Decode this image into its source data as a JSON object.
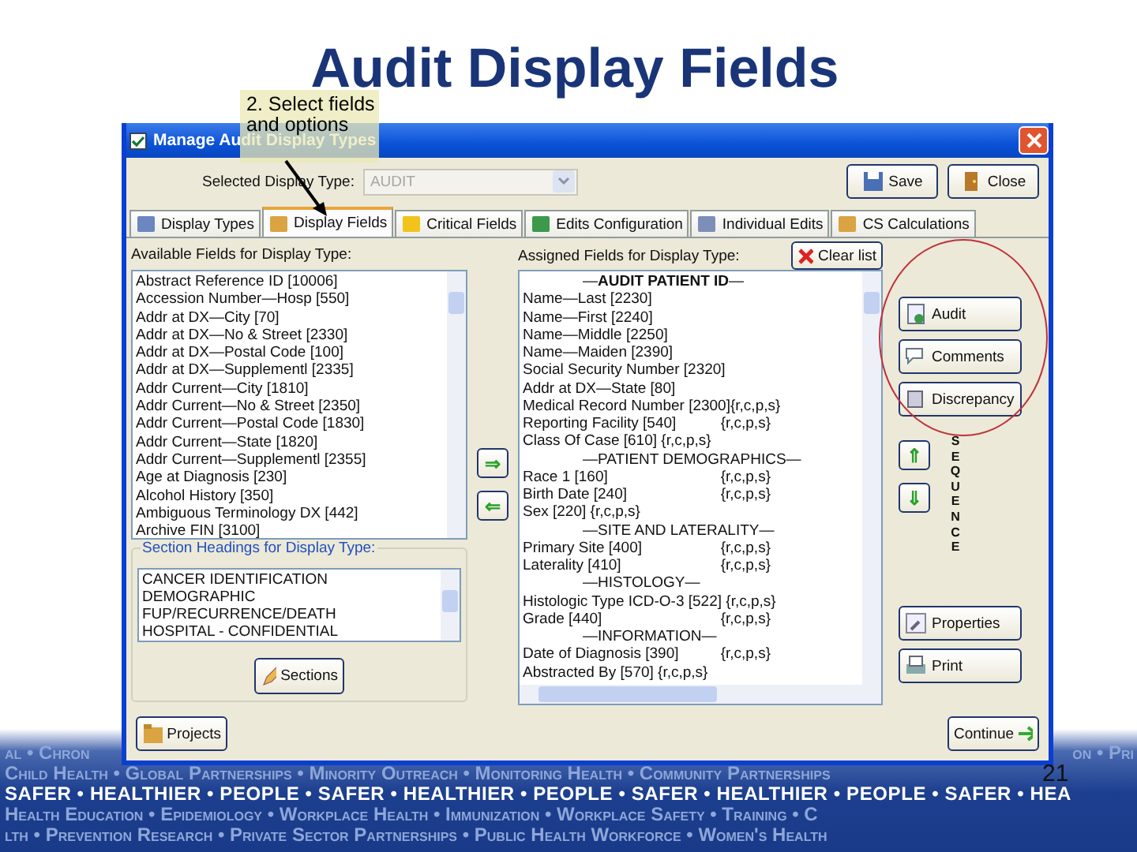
{
  "slide": {
    "title": "Audit Display Fields",
    "callout": "2. Select fields and options",
    "page_number": "21"
  },
  "window": {
    "title": "Manage Audit Display Types"
  },
  "display_type": {
    "label": "Selected Display Type:",
    "value": "AUDIT",
    "disabled": true
  },
  "top_buttons": [
    "Save",
    "Close"
  ],
  "tabs": [
    {
      "label": "Display Types",
      "selected": false
    },
    {
      "label": "Display Fields",
      "selected": true
    },
    {
      "label": "Critical Fields",
      "selected": false
    },
    {
      "label": "Edits Configuration",
      "selected": false
    },
    {
      "label": "Individual Edits",
      "selected": false
    },
    {
      "label": "CS Calculations",
      "selected": false
    }
  ],
  "available": {
    "label": "Available Fields for Display Type:",
    "items": [
      "Abstract Reference ID [10006]",
      "Accession Number—Hosp [550]",
      "Addr at DX—City [70]",
      "Addr at DX—No & Street [2330]",
      "Addr at DX—Postal Code [100]",
      "Addr at DX—Supplementl [2335]",
      "Addr Current—City [1810]",
      "Addr Current—No & Street [2350]",
      "Addr Current—Postal Code [1830]",
      "Addr Current—State [1820]",
      "Addr Current—Supplementl [2355]",
      "Age at Diagnosis [230]",
      "Alcohol History [350]",
      "Ambiguous Terminology DX [442]",
      "Archive FIN [3100]"
    ]
  },
  "move_buttons": [
    "⇒",
    "⇐"
  ],
  "sections": {
    "label": "Section Headings for Display Type:",
    "items": [
      "CANCER IDENTIFICATION",
      "DEMOGRAPHIC",
      "FUP/RECURRENCE/DEATH",
      "HOSPITAL - CONFIDENTIAL"
    ],
    "button": "Sections"
  },
  "assigned": {
    "label": "Assigned Fields for Display Type:",
    "clear_button": "Clear list",
    "items": [
      {
        "kind": "header",
        "text": "—**AUDIT PATIENT ID**—"
      },
      {
        "kind": "field",
        "text": "Name—Last [2230]"
      },
      {
        "kind": "field",
        "text": "Name—First [2240]"
      },
      {
        "kind": "field",
        "text": "Name—Middle [2250]"
      },
      {
        "kind": "field",
        "text": "Name—Maiden [2390]"
      },
      {
        "kind": "field",
        "text": "Social Security Number [2320]"
      },
      {
        "kind": "field",
        "text": "Addr at DX—State [80]"
      },
      {
        "kind": "field",
        "text": "Medical Record Number [2300]",
        "flags": "{r,c,p,s}"
      },
      {
        "kind": "field",
        "text": "Reporting Facility [540]",
        "flags": "{r,c,p,s}"
      },
      {
        "kind": "field",
        "text": "Class Of Case [610] {r,c,p,s}"
      },
      {
        "kind": "header",
        "text": "—PATIENT DEMOGRAPHICS—"
      },
      {
        "kind": "field",
        "text": "Race 1 [160]",
        "flags": "{r,c,p,s}"
      },
      {
        "kind": "field",
        "text": "Birth Date [240]",
        "flags": "{r,c,p,s}"
      },
      {
        "kind": "field",
        "text": "Sex [220] {r,c,p,s}"
      },
      {
        "kind": "header",
        "text": "—SITE AND LATERALITY—"
      },
      {
        "kind": "field",
        "text": "Primary Site [400]",
        "flags": "{r,c,p,s}"
      },
      {
        "kind": "field",
        "text": "Laterality [410]",
        "flags": "{r,c,p,s}"
      },
      {
        "kind": "header",
        "text": "—HISTOLOGY—"
      },
      {
        "kind": "field",
        "text": "Histologic Type ICD-O-3 [522] {r,c,p,s}"
      },
      {
        "kind": "field",
        "text": "Grade [440]",
        "flags": "{r,c,p,s}"
      },
      {
        "kind": "header",
        "text": "—INFORMATION—"
      },
      {
        "kind": "field",
        "text": "Date of Diagnosis [390]",
        "flags": "{r,c,p,s}"
      },
      {
        "kind": "field",
        "text": "Abstracted By [570] {r,c,p,s}"
      }
    ]
  },
  "side_buttons": [
    "Audit",
    "Comments",
    "Discrepancy"
  ],
  "sequence": {
    "label": "SEQUENCE",
    "buttons": [
      "⇑",
      "⇓"
    ]
  },
  "lower_buttons": [
    "Properties",
    "Print"
  ],
  "footer_buttons": {
    "left": "Projects",
    "right": "Continue"
  },
  "banner": {
    "line_1_left": "al • Chron",
    "line_1_right": "on • Pri",
    "lines": [
      {
        "kind": "dim",
        "text": "Child Health • Global Partnerships • Minority Outreach • Monitoring Health • Community Partnerships"
      },
      {
        "kind": "bright",
        "text": "SAFER • HEALTHIER • PEOPLE • SAFER • HEALTHIER • PEOPLE • SAFER • HEALTHIER • PEOPLE • SAFER • HEA"
      },
      {
        "kind": "dim",
        "text": "Health Education • Epidemiology • Workplace Health • Immunization • Workplace Safety • Training • C"
      },
      {
        "kind": "dim",
        "text": "lth • Prevention Research • Private Sector Partnerships • Public Health Workforce • Women's Health"
      }
    ]
  }
}
